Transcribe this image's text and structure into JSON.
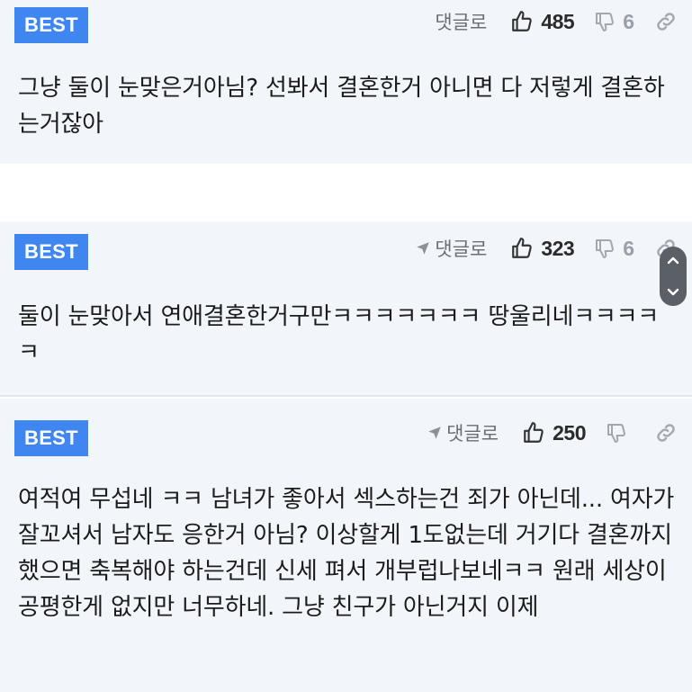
{
  "comments": [
    {
      "badge": "BEST",
      "reply_label": "댓글로",
      "likes": "485",
      "dislikes": "6",
      "text": "그냥 둘이 눈맞은거아님? 선봐서 결혼한거 아니면 다 저렇게 결혼하는거잖아"
    },
    {
      "badge": "BEST",
      "reply_label": "댓글로",
      "likes": "323",
      "dislikes": "6",
      "text": "둘이 눈맞아서 연애결혼한거구만ㅋㅋㅋㅋㅋㅋㅋ 땅울리네ㅋㅋㅋㅋㅋ"
    },
    {
      "badge": "BEST",
      "reply_label": "댓글로",
      "likes": "250",
      "dislikes": "",
      "text": "여적여 무섭네 ㅋㅋ 남녀가 좋아서 섹스하는건 죄가 아닌데... 여자가 잘꼬셔서 남자도 응한거 아님? 이상할게 1도없는데 거기다 결혼까지 했으면 축복해야 하는건데 신세 펴서 개부럽나보네ㅋㅋ 원래 세상이 공평한게 없지만 너무하네. 그냥 친구가 아닌거지 이제"
    }
  ],
  "colors": {
    "badge_bg": "#3f86f0",
    "card_bg": "#f2f5fa",
    "scroll_pill": "#5b5f66"
  },
  "icons": [
    "reply-arrow-icon",
    "thumbs-up-icon",
    "thumbs-down-icon",
    "link-icon",
    "scroll-up-icon",
    "scroll-down-icon"
  ]
}
